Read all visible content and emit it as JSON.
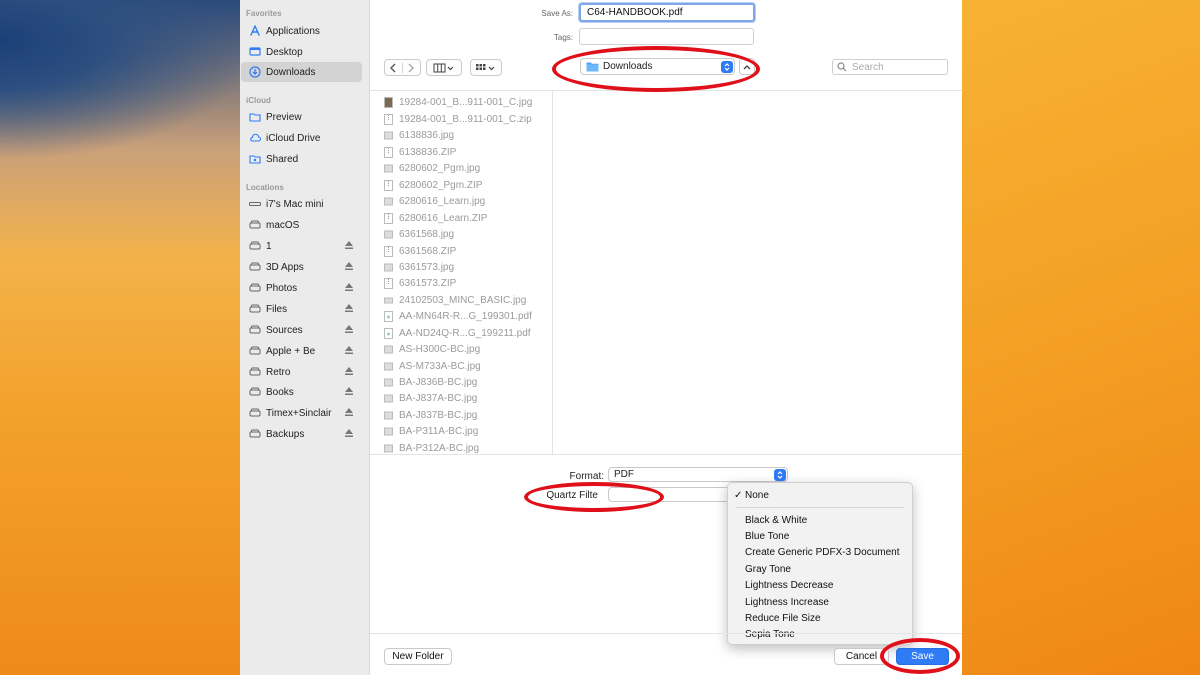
{
  "sidebar": {
    "favorites_header": "Favorites",
    "favorites": [
      {
        "label": "Applications",
        "icon": "applications-icon"
      },
      {
        "label": "Desktop",
        "icon": "desktop-icon"
      },
      {
        "label": "Downloads",
        "icon": "downloads-icon",
        "selected": true
      }
    ],
    "icloud_header": "iCloud",
    "icloud": [
      {
        "label": "Preview",
        "icon": "folder-icon"
      },
      {
        "label": "iCloud Drive",
        "icon": "cloud-icon"
      },
      {
        "label": "Shared",
        "icon": "shared-folder-icon"
      }
    ],
    "locations_header": "Locations",
    "locations": [
      {
        "label": "i7's Mac mini",
        "icon": "computer-icon"
      },
      {
        "label": "macOS",
        "icon": "drive-icon"
      },
      {
        "label": "1",
        "icon": "drive-icon",
        "eject": true
      },
      {
        "label": "3D Apps",
        "icon": "drive-icon",
        "eject": true
      },
      {
        "label": "Photos",
        "icon": "drive-icon",
        "eject": true
      },
      {
        "label": "Files",
        "icon": "drive-icon",
        "eject": true
      },
      {
        "label": "Sources",
        "icon": "drive-icon",
        "eject": true
      },
      {
        "label": "Apple + Be",
        "icon": "drive-icon",
        "eject": true
      },
      {
        "label": "Retro",
        "icon": "drive-icon",
        "eject": true
      },
      {
        "label": "Books",
        "icon": "drive-icon",
        "eject": true
      },
      {
        "label": "Timex+Sinclair",
        "icon": "drive-icon",
        "eject": true
      },
      {
        "label": "Backups",
        "icon": "drive-icon",
        "eject": true
      }
    ]
  },
  "save_as": {
    "label": "Save As:",
    "value": "C64-HANDBOOK.pdf"
  },
  "tags": {
    "label": "Tags:",
    "value": ""
  },
  "location_popup": {
    "label": "Downloads"
  },
  "search": {
    "placeholder": "Search"
  },
  "files": [
    "19284-001_B...911-001_C.jpg",
    "19284-001_B...911-001_C.zip",
    "6138836.jpg",
    "6138836.ZIP",
    "6280602_Pgm.jpg",
    "6280602_Pgm.ZIP",
    "6280616_Learn.jpg",
    "6280616_Learn.ZIP",
    "6361568.jpg",
    "6361568.ZIP",
    "6361573.jpg",
    "6361573.ZIP",
    "24102503_MINC_BASIC.jpg",
    "AA-MN64R-R...G_199301.pdf",
    "AA-ND24Q-R...G_199211.pdf",
    "AS-H300C-BC.jpg",
    "AS-M733A-BC.jpg",
    "BA-J836B-BC.jpg",
    "BA-J837A-BC.jpg",
    "BA-J837B-BC.jpg",
    "BA-P311A-BC.jpg",
    "BA-P312A-BC.jpg"
  ],
  "format": {
    "label": "Format:",
    "value": "PDF"
  },
  "quartz_filter": {
    "label": "Quartz Filte",
    "selected": "None",
    "check": "✓",
    "options": [
      "Black & White",
      "Blue Tone",
      "Create Generic PDFX-3 Document",
      "Gray Tone",
      "Lightness Decrease",
      "Lightness Increase",
      "Reduce File Size",
      "Sepia Tone"
    ]
  },
  "buttons": {
    "new_folder": "New Folder",
    "cancel": "Cancel",
    "save": "Save"
  },
  "colors": {
    "accent": "#2f7bf5",
    "highlight_ring": "#e0101a",
    "sidebar_bg": "#ebebeb"
  }
}
